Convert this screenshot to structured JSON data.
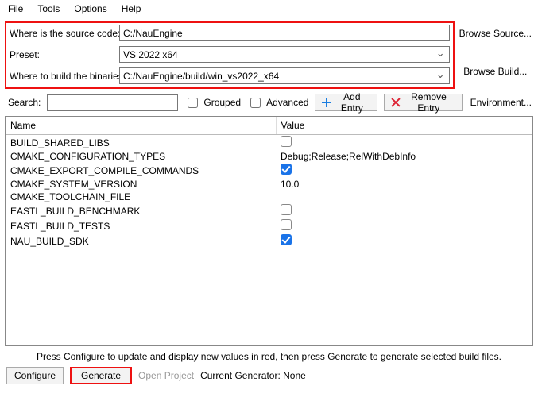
{
  "menu": {
    "file": "File",
    "tools": "Tools",
    "options": "Options",
    "help": "Help"
  },
  "labels": {
    "source": "Where is the source code:",
    "preset": "Preset:",
    "binaries": "Where to build the binaries:",
    "browse_source": "Browse Source...",
    "browse_build": "Browse Build...",
    "search": "Search:",
    "grouped": "Grouped",
    "advanced": "Advanced",
    "add_entry": "Add Entry",
    "remove_entry": "Remove Entry",
    "environment": "Environment...",
    "col_name": "Name",
    "col_value": "Value",
    "hint": "Press Configure to update and display new values in red, then press Generate to generate selected build files.",
    "configure": "Configure",
    "generate": "Generate",
    "open_project": "Open Project",
    "generator": "Current Generator: None"
  },
  "fields": {
    "source_path": "C:/NauEngine",
    "preset": "VS 2022 x64",
    "build_path": "C:/NauEngine/build/win_vs2022_x64",
    "search": ""
  },
  "checks": {
    "grouped": false,
    "advanced": false
  },
  "cache": [
    {
      "name": "BUILD_SHARED_LIBS",
      "type": "bool",
      "checked": false
    },
    {
      "name": "CMAKE_CONFIGURATION_TYPES",
      "type": "text",
      "value": "Debug;Release;RelWithDebInfo"
    },
    {
      "name": "CMAKE_EXPORT_COMPILE_COMMANDS",
      "type": "bool",
      "checked": true
    },
    {
      "name": "CMAKE_SYSTEM_VERSION",
      "type": "text",
      "value": "10.0"
    },
    {
      "name": "CMAKE_TOOLCHAIN_FILE",
      "type": "text",
      "value": ""
    },
    {
      "name": "EASTL_BUILD_BENCHMARK",
      "type": "bool",
      "checked": false
    },
    {
      "name": "EASTL_BUILD_TESTS",
      "type": "bool",
      "checked": false
    },
    {
      "name": "NAU_BUILD_SDK",
      "type": "bool",
      "checked": true
    }
  ]
}
